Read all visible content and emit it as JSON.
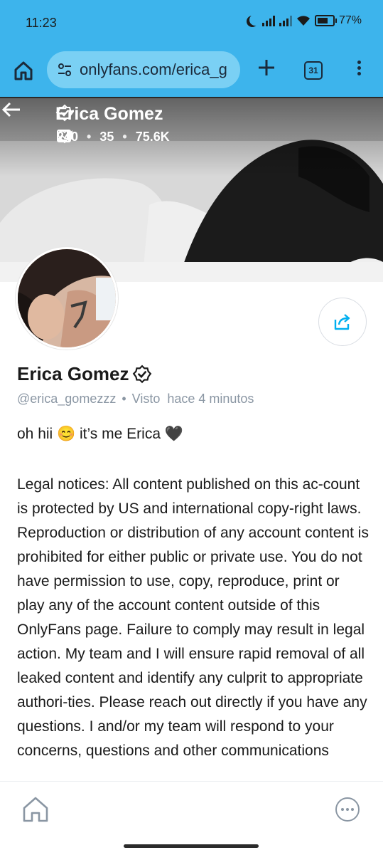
{
  "status_bar": {
    "time": "11:23",
    "battery": "77%"
  },
  "browser": {
    "url": "onlyfans.com/erica_g",
    "tab_count": "31"
  },
  "cover": {
    "name": "Erica Gomez",
    "photos": "240",
    "videos": "35",
    "likes": "75.6K"
  },
  "profile": {
    "name": "Erica Gomez",
    "handle": "@erica_gomezzz",
    "separator": "•",
    "last_seen": "Visto  hace 4 minutos",
    "bio": "oh hii 😊 it’s me Erica 🖤",
    "legal": "Legal notices: All content published on this ac-count is protected by US and international copy-right laws. Reproduction or distribution of any account content is prohibited for either public or private use. You do not have permission to use, copy, reproduce, print or play any of the account content outside of this OnlyFans page. Failure to comply may result in legal action. My team and I will ensure rapid removal of all leaked content and identify any culprit to appropriate authori-ties. Please reach out directly if you have any questions. I and/or my team will respond to your concerns, questions and other communications"
  },
  "colors": {
    "accent": "#3db4ec",
    "link_blue": "#00aff0",
    "muted": "#8a96a3"
  }
}
